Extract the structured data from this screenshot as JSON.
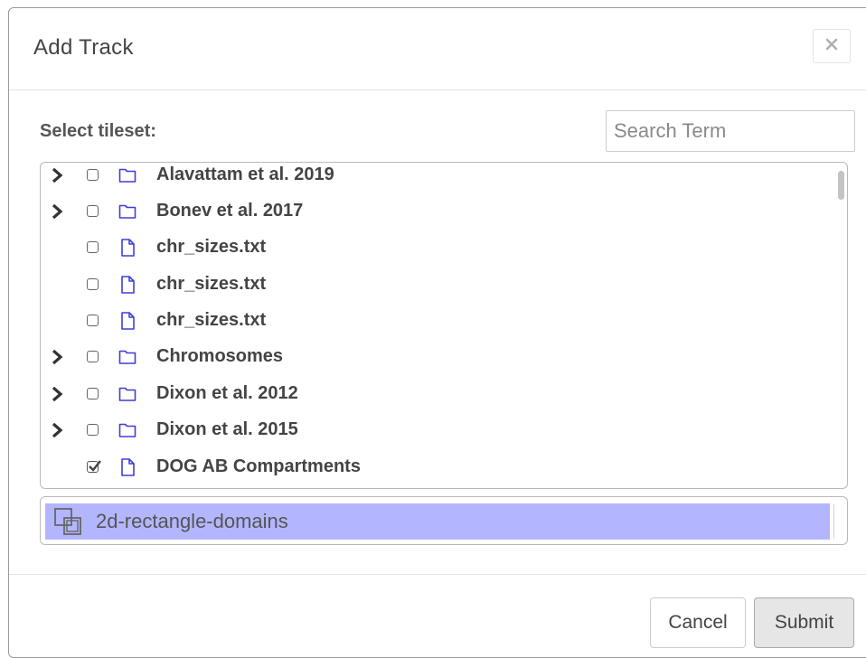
{
  "dialog": {
    "title": "Add Track",
    "close_icon": "close-icon"
  },
  "select_label": "Select tileset:",
  "search": {
    "placeholder": "Search Term",
    "value": ""
  },
  "tree": {
    "items": [
      {
        "label": "Alavattam et al. 2019",
        "type": "folder",
        "expandable": true,
        "checked": false
      },
      {
        "label": "Bonev et al. 2017",
        "type": "folder",
        "expandable": true,
        "checked": false
      },
      {
        "label": "chr_sizes.txt",
        "type": "file",
        "expandable": false,
        "checked": false
      },
      {
        "label": "chr_sizes.txt",
        "type": "file",
        "expandable": false,
        "checked": false
      },
      {
        "label": "chr_sizes.txt",
        "type": "file",
        "expandable": false,
        "checked": false
      },
      {
        "label": "Chromosomes",
        "type": "folder",
        "expandable": true,
        "checked": false
      },
      {
        "label": "Dixon et al. 2012",
        "type": "folder",
        "expandable": true,
        "checked": false
      },
      {
        "label": "Dixon et al. 2015",
        "type": "folder",
        "expandable": true,
        "checked": false
      },
      {
        "label": "DOG AB Compartments",
        "type": "file",
        "expandable": false,
        "checked": true
      }
    ]
  },
  "datatypes": {
    "selected": "2d-rectangle-domains",
    "icon": "2d-rectangle-domains-icon",
    "highlight_color": "#b3b6ff"
  },
  "footer": {
    "cancel_label": "Cancel",
    "submit_label": "Submit"
  },
  "colors": {
    "icon_blue": "#3f3fd6"
  }
}
